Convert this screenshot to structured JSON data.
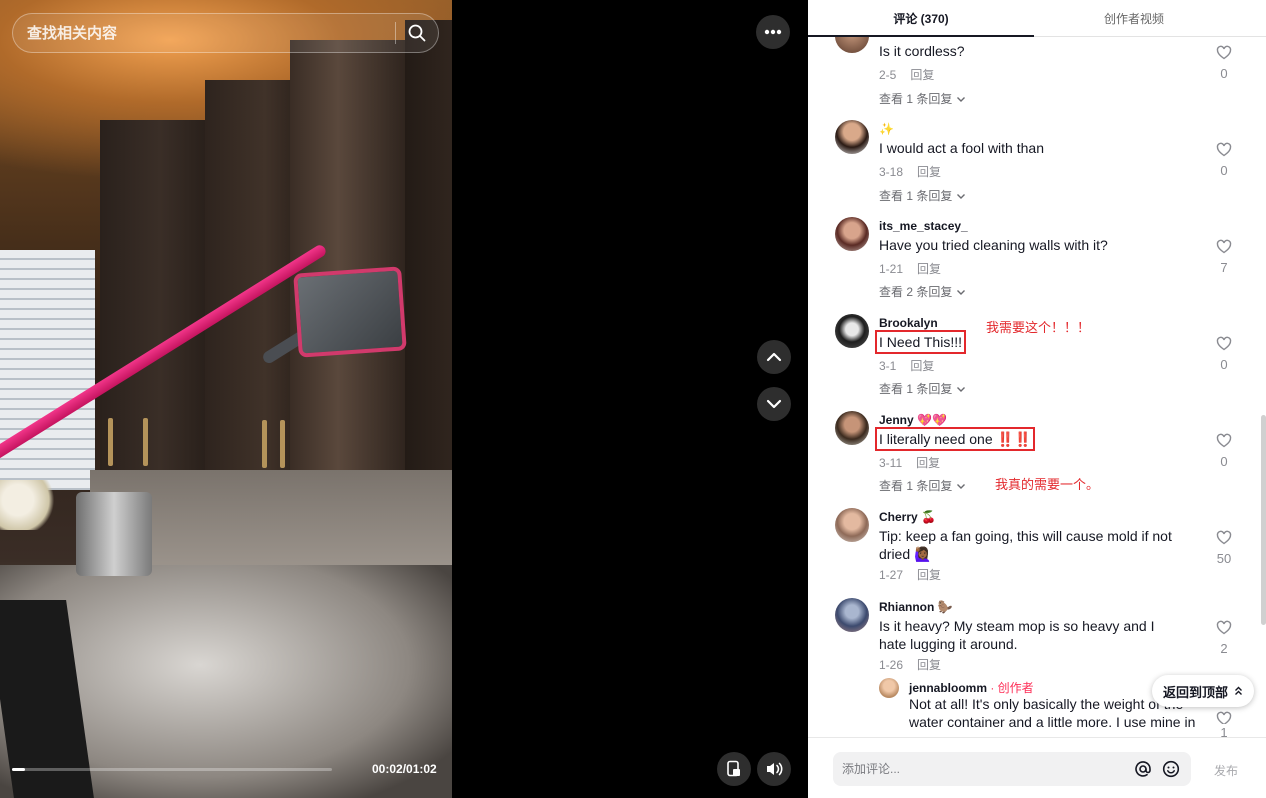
{
  "search": {
    "placeholder": "查找相关内容"
  },
  "player": {
    "timecode": "00:02/01:02",
    "progress_fraction": 0.04
  },
  "tabs": [
    {
      "label": "评论 (370)",
      "active": true
    },
    {
      "label": "创作者视频",
      "active": false
    }
  ],
  "comments": [
    {
      "username": "",
      "text": "Is it cordless?",
      "date": "2-5",
      "reply_label": "回复",
      "likes": "0",
      "view_replies": "查看 1 条回复"
    },
    {
      "username": "✨",
      "text": "I would act a fool with than",
      "date": "3-18",
      "reply_label": "回复",
      "likes": "0",
      "view_replies": "查看 1 条回复"
    },
    {
      "username": "its_me_stacey_",
      "text": "Have you tried cleaning walls with it?",
      "date": "1-21",
      "reply_label": "回复",
      "likes": "7",
      "view_replies": "查看 2 条回复"
    },
    {
      "username": "Brookalyn",
      "text": "I Need This!!!",
      "date": "3-1",
      "reply_label": "回复",
      "likes": "0",
      "view_replies": "查看 1 条回复",
      "annotation": "我需要这个！！！"
    },
    {
      "username": "Jenny 💖💖",
      "text": "I literally need one ‼️‼️",
      "date": "3-11",
      "reply_label": "回复",
      "likes": "0",
      "view_replies": "查看 1 条回复",
      "annotation": "我真的需要一个。"
    },
    {
      "username": "Cherry 🍒",
      "text": "Tip: keep a fan going, this will cause mold if not dried 🙋🏾‍♀️",
      "date": "1-27",
      "reply_label": "回复",
      "likes": "50"
    },
    {
      "username": "Rhiannon 🦫",
      "text": "Is it heavy? My steam mop is so heavy and I hate lugging it around.",
      "date": "1-26",
      "reply_label": "回复",
      "likes": "2"
    }
  ],
  "reply": {
    "username": "jennabloomm",
    "creator_tag": " · 创作者",
    "text": "Not at all! It's only basically the weight of the water container and a little more. I use mine in",
    "likes": "1"
  },
  "back_to_top": "返回到顶部",
  "composer": {
    "placeholder": "添加评论...",
    "post_label": "发布"
  },
  "icons": [
    "search-icon",
    "more-icon",
    "chevron-up-icon",
    "chevron-down-icon",
    "pip-icon",
    "volume-icon",
    "heart-icon",
    "chevron-down-small-icon",
    "at-icon",
    "emoji-icon",
    "chevron-up-small-icon"
  ]
}
